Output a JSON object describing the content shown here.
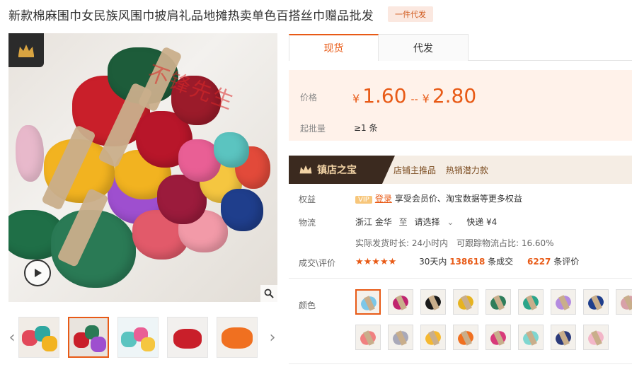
{
  "header": {
    "title": "新款棉麻围巾女民族风围巾披肩礼品地摊热卖单色百搭丝巾赠品批发",
    "tag": "一件代发"
  },
  "gallery": {
    "watermark": "不锋先生",
    "play_icon": "play-icon",
    "zoom_icon": "magnifier-icon",
    "prev_icon": "chevron-left-icon",
    "next_icon": "chevron-right-icon",
    "thumbnails_count": 5,
    "active_thumbnail": 2
  },
  "tabs": [
    {
      "label": "现货",
      "active": true
    },
    {
      "label": "代发",
      "active": false
    }
  ],
  "pricing": {
    "price_label": "价格",
    "currency": "¥",
    "min_price": "1.60",
    "range_sep": "--",
    "max_price": "2.80",
    "moq_label": "起批量",
    "moq_value": "≥1 条"
  },
  "shop": {
    "badge": "镇店之宝",
    "link1": "店铺主推品",
    "link2": "热销潜力款"
  },
  "benefits": {
    "label": "权益",
    "vip": "VIP",
    "login": "登录",
    "text": "享受会员价、淘宝数据等更多权益"
  },
  "logistics": {
    "label": "物流",
    "origin": "浙江 金华",
    "to": "至",
    "select": "请选择",
    "express": "快递 ¥4",
    "ship_time": "实际发货时长: 24小时内",
    "ratio": "可跟踪物流占比: 16.60%"
  },
  "reviews": {
    "label": "成交\\评价",
    "stars": "★★★★★",
    "rating": 4.5,
    "deals_prefix": "30天内",
    "deals_count": "138618",
    "deals_suffix": "条成交",
    "review_count": "6227",
    "review_suffix": "条评价"
  },
  "colors": {
    "label": "颜色",
    "swatches": [
      "#7cc7e8",
      "#c0246f",
      "#1a1a1a",
      "#e6b320",
      "#2e7d5a",
      "#2aa58a",
      "#b48be0",
      "#1f3e8c",
      "#d8a0a8",
      "#f08080",
      "#a9a9b9",
      "#f5b830",
      "#f07020",
      "#d83a7a",
      "#7fd6d0",
      "#2b3a7a",
      "#f3b6c8"
    ]
  },
  "accent": "#e85a16"
}
